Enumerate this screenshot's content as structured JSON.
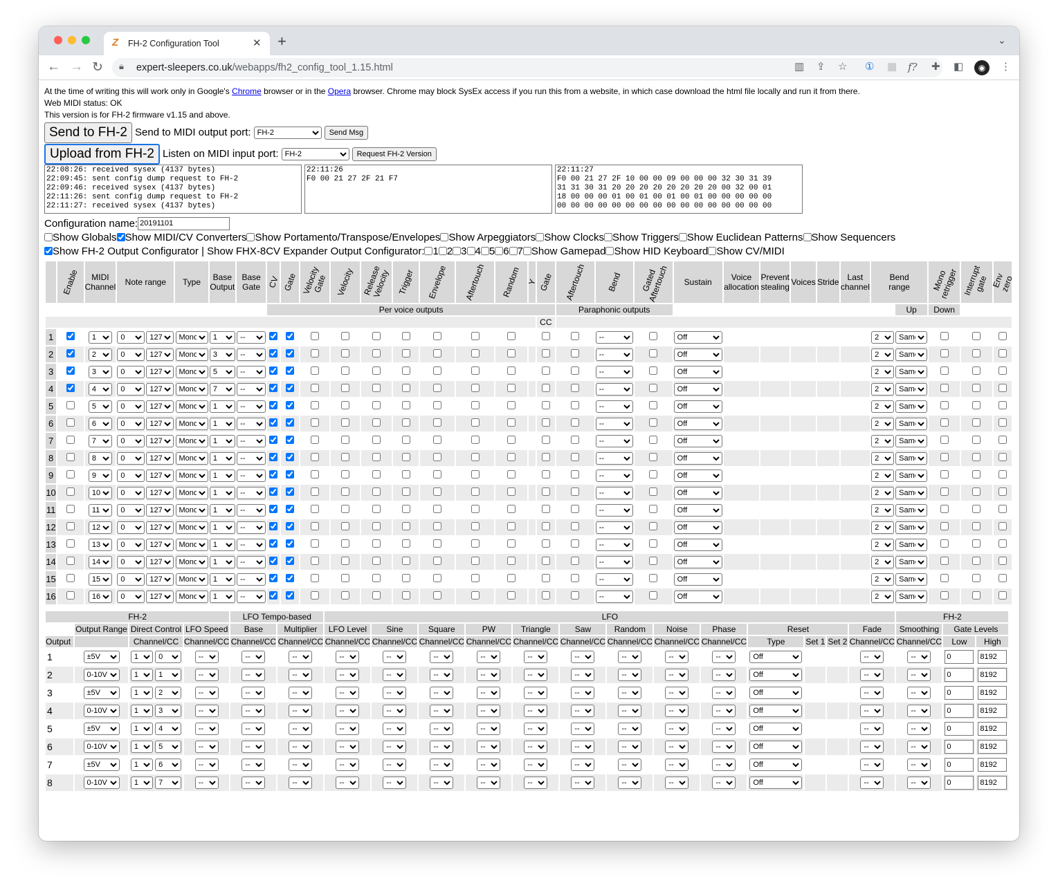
{
  "browser": {
    "tab_title": "FH-2 Configuration Tool",
    "url_host": "expert-sleepers.co.uk",
    "url_path": "/webapps/fh2_config_tool_1.15.html",
    "ext_label": "f?"
  },
  "intro": {
    "l1a": "At the time of writing this will work only in Google's ",
    "chrome": "Chrome",
    "l1b": " browser or in the ",
    "opera": "Opera",
    "l1c": " browser. Chrome may block SysEx access if you run this from a website, in which case download the html file locally and run it from there.",
    "status": "Web MIDI status: OK",
    "version": "This version is for FH-2 firmware v1.15 and above."
  },
  "controls": {
    "send_btn": "Send to FH-2",
    "send_port_label": "Send to MIDI output port:",
    "out_port": "FH-2",
    "send_msg_btn": "Send Msg",
    "upload_btn": "Upload from FH-2",
    "listen_label": "Listen on MIDI input port:",
    "in_port": "FH-2",
    "request_btn": "Request FH-2 Version"
  },
  "logs": {
    "log1": "22:08:26: received sysex (4137 bytes)\n22:09:45: sent config dump request to FH-2\n22:09:46: received sysex (4137 bytes)\n22:11:26: sent config dump request to FH-2\n22:11:27: received sysex (4137 bytes)",
    "log2": "22:11:26\nF0 00 21 27 2F 21 F7",
    "log3": "22:11:27\nF0 00 21 27 2F 10 00 00 09 00 00 00 32 30 31 39\n31 31 30 31 20 20 20 20 20 20 20 20 00 32 00 01\n18 00 00 00 01 00 01 00 01 00 01 00 00 00 00 00\n00 00 00 00 00 00 00 00 00 00 00 00 00 00 00 00"
  },
  "config": {
    "label": "Configuration name:",
    "value": "20191101"
  },
  "options": {
    "row1": [
      {
        "label": "Show Globals",
        "checked": false
      },
      {
        "label": "Show MIDI/CV Converters",
        "checked": true
      },
      {
        "label": "Show Portamento/Transpose/Envelopes",
        "checked": false
      },
      {
        "label": "Show Arpeggiators",
        "checked": false
      },
      {
        "label": "Show Clocks",
        "checked": false
      },
      {
        "label": "Show Triggers",
        "checked": false
      },
      {
        "label": "Show Euclidean Patterns",
        "checked": false
      },
      {
        "label": "Show Sequencers",
        "checked": false
      }
    ],
    "row2_first": {
      "label": "Show FH-2 Output Configurator | Show FHX-8CV Expander Output Configurator:",
      "checked": true
    },
    "row2_nums": [
      "1",
      "2",
      "3",
      "4",
      "5",
      "6",
      "7"
    ],
    "row2_rest": [
      {
        "label": "Show Gamepad",
        "checked": false
      },
      {
        "label": "Show HID Keyboard",
        "checked": false
      },
      {
        "label": "Show CV/MIDI",
        "checked": false
      }
    ]
  },
  "conv": {
    "h": {
      "enable": "Enable",
      "midi1": "MIDI",
      "midi2": "Channel",
      "note_range": "Note range",
      "type": "Type",
      "bo1": "Base",
      "bo2": "Output",
      "bg1": "Base",
      "bg2": "Gate",
      "cv": "CV",
      "gate": "Gate",
      "vg1": "Velocity",
      "vg2": "Gate",
      "vel": "Velocity",
      "rv1": "Release",
      "rv2": "Velocity",
      "trig": "Trigger",
      "env": "Envelope",
      "at": "Aftertouch",
      "rand": "Random",
      "y": "Y",
      "pgate": "Gate",
      "pat": "Aftertouch",
      "bend": "Bend",
      "ga1": "Gated",
      "ga2": "Aftertouch",
      "sustain": "Sustain",
      "va1": "Voice",
      "va2": "allocation",
      "ps1": "Prevent",
      "ps2": "stealing",
      "voices": "Voices",
      "stride": "Stride",
      "lc1": "Last",
      "lc2": "channel",
      "br1": "Bend",
      "br2": "range",
      "mr1": "Mono",
      "mr2": "retrigger",
      "ig1": "Interrupt",
      "ig2": "gate",
      "ez1": "Env",
      "ez2": "zero",
      "per_voice": "Per voice outputs",
      "paraphonic": "Paraphonic outputs",
      "up": "Up",
      "down": "Down",
      "cc": "CC"
    },
    "rows": [
      {
        "n": "1",
        "en": true,
        "ch": "1",
        "lo": "0",
        "hi": "127",
        "type": "Mono",
        "bo": "1",
        "bg": "--",
        "bend": "--",
        "sus": "Off",
        "up": "2",
        "dn": "Same"
      },
      {
        "n": "2",
        "en": true,
        "ch": "2",
        "lo": "0",
        "hi": "127",
        "type": "Mono",
        "bo": "3",
        "bg": "--",
        "bend": "--",
        "sus": "Off",
        "up": "2",
        "dn": "Same"
      },
      {
        "n": "3",
        "en": true,
        "ch": "3",
        "lo": "0",
        "hi": "127",
        "type": "Mono",
        "bo": "5",
        "bg": "--",
        "bend": "--",
        "sus": "Off",
        "up": "2",
        "dn": "Same"
      },
      {
        "n": "4",
        "en": true,
        "ch": "4",
        "lo": "0",
        "hi": "127",
        "type": "Mono",
        "bo": "7",
        "bg": "--",
        "bend": "--",
        "sus": "Off",
        "up": "2",
        "dn": "Same"
      },
      {
        "n": "5",
        "en": false,
        "ch": "5",
        "lo": "0",
        "hi": "127",
        "type": "Mono",
        "bo": "1",
        "bg": "--",
        "bend": "--",
        "sus": "Off",
        "up": "2",
        "dn": "Same"
      },
      {
        "n": "6",
        "en": false,
        "ch": "6",
        "lo": "0",
        "hi": "127",
        "type": "Mono",
        "bo": "1",
        "bg": "--",
        "bend": "--",
        "sus": "Off",
        "up": "2",
        "dn": "Same"
      },
      {
        "n": "7",
        "en": false,
        "ch": "7",
        "lo": "0",
        "hi": "127",
        "type": "Mono",
        "bo": "1",
        "bg": "--",
        "bend": "--",
        "sus": "Off",
        "up": "2",
        "dn": "Same"
      },
      {
        "n": "8",
        "en": false,
        "ch": "8",
        "lo": "0",
        "hi": "127",
        "type": "Mono",
        "bo": "1",
        "bg": "--",
        "bend": "--",
        "sus": "Off",
        "up": "2",
        "dn": "Same"
      },
      {
        "n": "9",
        "en": false,
        "ch": "9",
        "lo": "0",
        "hi": "127",
        "type": "Mono",
        "bo": "1",
        "bg": "--",
        "bend": "--",
        "sus": "Off",
        "up": "2",
        "dn": "Same"
      },
      {
        "n": "10",
        "en": false,
        "ch": "10",
        "lo": "0",
        "hi": "127",
        "type": "Mono",
        "bo": "1",
        "bg": "--",
        "bend": "--",
        "sus": "Off",
        "up": "2",
        "dn": "Same"
      },
      {
        "n": "11",
        "en": false,
        "ch": "11",
        "lo": "0",
        "hi": "127",
        "type": "Mono",
        "bo": "1",
        "bg": "--",
        "bend": "--",
        "sus": "Off",
        "up": "2",
        "dn": "Same"
      },
      {
        "n": "12",
        "en": false,
        "ch": "12",
        "lo": "0",
        "hi": "127",
        "type": "Mono",
        "bo": "1",
        "bg": "--",
        "bend": "--",
        "sus": "Off",
        "up": "2",
        "dn": "Same"
      },
      {
        "n": "13",
        "en": false,
        "ch": "13",
        "lo": "0",
        "hi": "127",
        "type": "Mono",
        "bo": "1",
        "bg": "--",
        "bend": "--",
        "sus": "Off",
        "up": "2",
        "dn": "Same"
      },
      {
        "n": "14",
        "en": false,
        "ch": "14",
        "lo": "0",
        "hi": "127",
        "type": "Mono",
        "bo": "1",
        "bg": "--",
        "bend": "--",
        "sus": "Off",
        "up": "2",
        "dn": "Same"
      },
      {
        "n": "15",
        "en": false,
        "ch": "15",
        "lo": "0",
        "hi": "127",
        "type": "Mono",
        "bo": "1",
        "bg": "--",
        "bend": "--",
        "sus": "Off",
        "up": "2",
        "dn": "Same"
      },
      {
        "n": "16",
        "en": false,
        "ch": "16",
        "lo": "0",
        "hi": "127",
        "type": "Mono",
        "bo": "1",
        "bg": "--",
        "bend": "--",
        "sus": "Off",
        "up": "2",
        "dn": "Same"
      }
    ]
  },
  "outcfg": {
    "h": {
      "fh2": "FH-2",
      "lfo_tempo": "LFO Tempo-based",
      "lfo": "LFO",
      "fh2b": "FH-2",
      "output_range": "Output Range",
      "direct_control": "Direct Control",
      "lfo_speed": "LFO Speed",
      "base": "Base",
      "multiplier": "Multiplier",
      "lfo_level": "LFO Level",
      "sine": "Sine",
      "square": "Square",
      "pw": "PW",
      "triangle": "Triangle",
      "saw": "Saw",
      "random": "Random",
      "noise": "Noise",
      "phase": "Phase",
      "reset": "Reset",
      "fade": "Fade",
      "smoothing": "Smoothing",
      "gate_levels": "Gate Levels",
      "output": "Output",
      "chcc": "Channel/CC",
      "type": "Type",
      "set1": "Set 1",
      "set2": "Set 2",
      "low": "Low",
      "high": "High"
    },
    "rows": [
      {
        "n": "1",
        "range": "±5V",
        "dc_ch": "1",
        "dc_cc": "0",
        "reset": "Off",
        "low": "0",
        "high": "8192"
      },
      {
        "n": "2",
        "range": "0-10V",
        "dc_ch": "1",
        "dc_cc": "1",
        "reset": "Off",
        "low": "0",
        "high": "8192"
      },
      {
        "n": "3",
        "range": "±5V",
        "dc_ch": "1",
        "dc_cc": "2",
        "reset": "Off",
        "low": "0",
        "high": "8192"
      },
      {
        "n": "4",
        "range": "0-10V",
        "dc_ch": "1",
        "dc_cc": "3",
        "reset": "Off",
        "low": "0",
        "high": "8192"
      },
      {
        "n": "5",
        "range": "±5V",
        "dc_ch": "1",
        "dc_cc": "4",
        "reset": "Off",
        "low": "0",
        "high": "8192"
      },
      {
        "n": "6",
        "range": "0-10V",
        "dc_ch": "1",
        "dc_cc": "5",
        "reset": "Off",
        "low": "0",
        "high": "8192"
      },
      {
        "n": "7",
        "range": "±5V",
        "dc_ch": "1",
        "dc_cc": "6",
        "reset": "Off",
        "low": "0",
        "high": "8192"
      },
      {
        "n": "8",
        "range": "0-10V",
        "dc_ch": "1",
        "dc_cc": "7",
        "reset": "Off",
        "low": "0",
        "high": "8192"
      }
    ],
    "empty_select": "--"
  }
}
